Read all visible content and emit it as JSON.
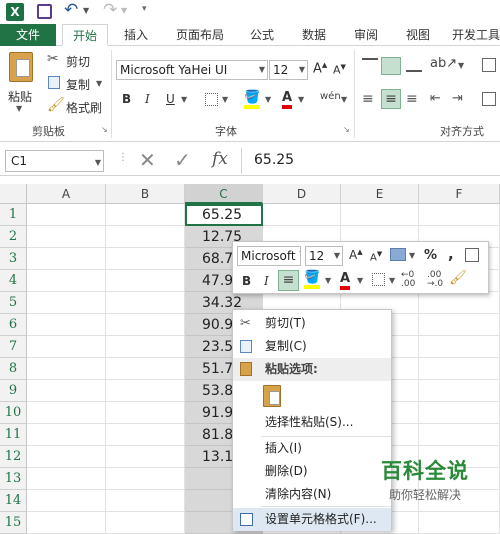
{
  "tabs": [
    "文件",
    "开始",
    "插入",
    "页面布局",
    "公式",
    "数据",
    "审阅",
    "视图",
    "开发工具"
  ],
  "clipboard": {
    "paste": "粘贴",
    "cut": "剪切",
    "copy": "复制",
    "format_painter": "格式刷",
    "group": "剪贴板"
  },
  "font": {
    "name": "Microsoft YaHei UI",
    "size": "12",
    "group": "字体"
  },
  "alignment": {
    "group": "对齐方式"
  },
  "formula_bar": {
    "name_box": "C1",
    "fx": "fx",
    "value": "65.25"
  },
  "columns": [
    "A",
    "B",
    "C",
    "D",
    "E",
    "F"
  ],
  "rows": [
    "1",
    "2",
    "3",
    "4",
    "5",
    "6",
    "7",
    "8",
    "9",
    "10",
    "11",
    "12",
    "13",
    "14",
    "15"
  ],
  "c_values": [
    "65.25",
    "12.75",
    "68.7",
    "47.9",
    "34.32",
    "90.9",
    "23.5",
    "51.7",
    "53.8",
    "91.9",
    "81.8",
    "13.1"
  ],
  "mini_toolbar": {
    "font": "Microsoft YaHei UI",
    "size": "12",
    "percent": "%",
    "comma": ","
  },
  "context_menu": {
    "cut": "剪切(T)",
    "copy": "复制(C)",
    "paste_options": "粘贴选项:",
    "paste_special": "选择性粘贴(S)...",
    "insert": "插入(I)",
    "delete": "删除(D)",
    "clear": "清除内容(N)",
    "format_cells": "设置单元格格式(F)..."
  },
  "watermark": {
    "title": "百科全说",
    "subtitle": "助你轻松解决"
  }
}
